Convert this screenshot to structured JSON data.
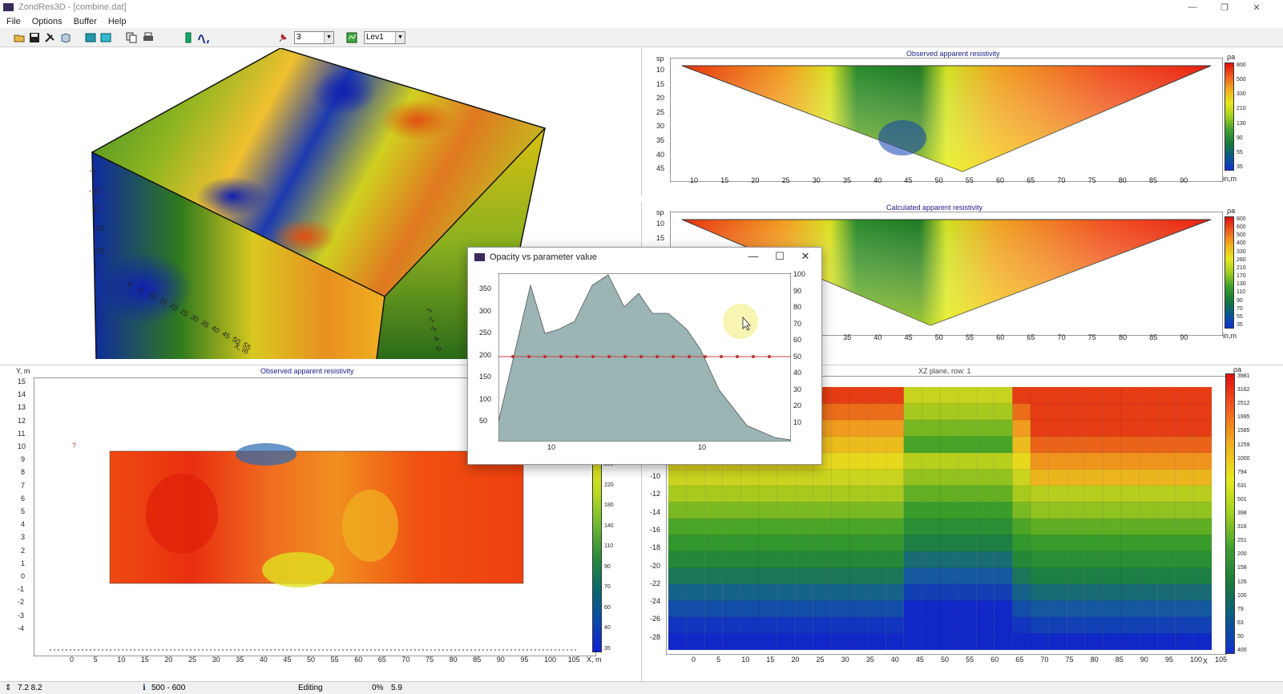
{
  "window": {
    "title": "ZondRes3D - [combine.dat]",
    "min_glyph": "—",
    "max_glyph": "❐",
    "close_glyph": "✕"
  },
  "menu": [
    "File",
    "Options",
    "Buffer",
    "Help"
  ],
  "toolbar": {
    "combo1_value": "3",
    "combo2_value": "Lev1",
    "icons": [
      "open-icon",
      "save-icon",
      "tools-icon",
      "cube-icon",
      "view3d-icon",
      "view3d-alt-icon",
      "copy-icon",
      "print-icon",
      "battery-icon",
      "waves-icon",
      "pin-icon",
      "grid-icon"
    ]
  },
  "top_right": {
    "title": "Observed apparent resistivity",
    "ylabel": "sp",
    "yticks": [
      "10",
      "15",
      "20",
      "25",
      "30",
      "35",
      "40",
      "45"
    ],
    "xticks": [
      "10",
      "15",
      "20",
      "25",
      "30",
      "35",
      "40",
      "45",
      "50",
      "55",
      "60",
      "65",
      "70",
      "75",
      "80",
      "85",
      "90"
    ],
    "xunit": "in,m",
    "cbar_unit": "ρa",
    "cbar_ticks": [
      "800",
      "500",
      "330",
      "210",
      "130",
      "90",
      "55",
      "35"
    ]
  },
  "mid_right": {
    "title": "Calculated apparent resistivity",
    "ylabel": "sp",
    "yticks": [
      "10",
      "15"
    ],
    "xticks": [
      "30",
      "35",
      "40",
      "45",
      "50",
      "55",
      "60",
      "65",
      "70",
      "75",
      "80",
      "85",
      "90"
    ],
    "xunit": "in,m",
    "cbar_unit": "ρa",
    "cbar_ticks": [
      "800",
      "600",
      "500",
      "400",
      "330",
      "260",
      "210",
      "170",
      "130",
      "110",
      "90",
      "70",
      "55",
      "35"
    ]
  },
  "bottom_left": {
    "title": "Observed apparent resistivity",
    "ylabel": "Y, m",
    "yticks": [
      "15",
      "14",
      "13",
      "12",
      "11",
      "10",
      "9",
      "8",
      "7",
      "6",
      "5",
      "4",
      "3",
      "2",
      "1",
      "0",
      "-1",
      "-2",
      "-3",
      "-4"
    ],
    "xticks": [
      "0",
      "5",
      "10",
      "15",
      "20",
      "25",
      "30",
      "35",
      "40",
      "45",
      "50",
      "55",
      "60",
      "65",
      "70",
      "75",
      "80",
      "85",
      "90",
      "95",
      "100",
      "105"
    ],
    "xunit": "X, m",
    "marker": "?",
    "cbar_ticks": [
      "280",
      "220",
      "180",
      "140",
      "110",
      "90",
      "70",
      "60",
      "40",
      "35"
    ]
  },
  "bottom_right": {
    "title": "XZ plane, row: 1",
    "yticks": [
      "-10",
      "-12",
      "-14",
      "-16",
      "-18",
      "-20",
      "-22",
      "-24",
      "-26",
      "-28"
    ],
    "xticks": [
      "0",
      "5",
      "10",
      "15",
      "20",
      "25",
      "30",
      "35",
      "40",
      "45",
      "50",
      "55",
      "60",
      "65",
      "70",
      "75",
      "80",
      "85",
      "90",
      "95",
      "100",
      "105"
    ],
    "xunit": "X",
    "cbar_unit": "ρa",
    "cbar_ticks": [
      "3981",
      "3162",
      "2512",
      "1995",
      "1585",
      "1259",
      "1000",
      "794",
      "631",
      "501",
      "398",
      "316",
      "251",
      "200",
      "158",
      "126",
      "100",
      "79",
      "63",
      "50",
      "400"
    ]
  },
  "cube": {
    "side_ticks": [
      "-5",
      "-10",
      "Z",
      "-20",
      "-25"
    ],
    "x_label": "X, m",
    "x_ticks": [
      "0",
      "5",
      "10",
      "15",
      "20",
      "25",
      "30",
      "35",
      "40",
      "45",
      "50",
      "55"
    ],
    "y_ticks": [
      "5",
      "4",
      "3",
      "2",
      "1"
    ]
  },
  "dialog": {
    "title": "Opacity vs parameter value",
    "yticks_left": [
      "350",
      "300",
      "250",
      "200",
      "150",
      "100",
      "50"
    ],
    "yticks_right": [
      "100",
      "90",
      "80",
      "70",
      "60",
      "50",
      "40",
      "30",
      "20",
      "10"
    ],
    "xticks": [
      "10",
      "10"
    ],
    "threshold_value": 200
  },
  "statusbar": {
    "coords": "7.2 8.2",
    "range": "500 - 600",
    "mode": "Editing",
    "percent": "0%",
    "value": "5.9"
  }
}
